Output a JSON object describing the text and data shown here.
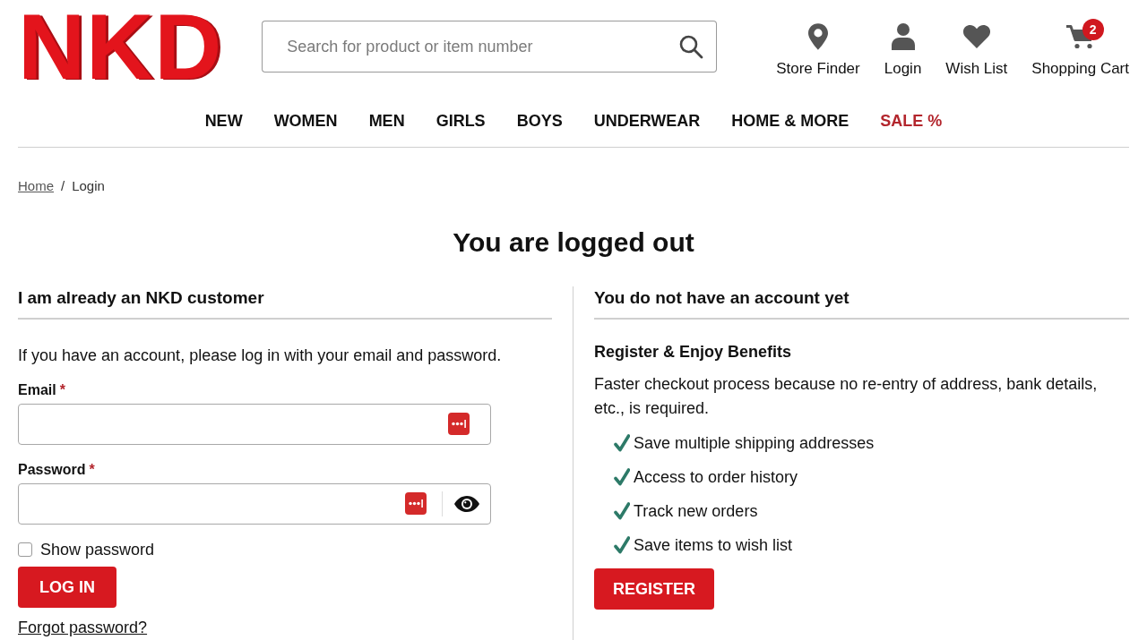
{
  "header": {
    "logo": "NKD",
    "search": {
      "placeholder": "Search for product or item number"
    },
    "actions": [
      {
        "kind": "store",
        "label": "Store Finder"
      },
      {
        "kind": "account",
        "label": "Login"
      },
      {
        "kind": "wishlist",
        "label": "Wish List"
      },
      {
        "kind": "cart",
        "label": "Shopping Cart",
        "badge": "2"
      }
    ]
  },
  "nav": [
    {
      "label": "NEW",
      "kind": "regular"
    },
    {
      "label": "WOMEN",
      "kind": "regular"
    },
    {
      "label": "MEN",
      "kind": "regular"
    },
    {
      "label": "GIRLS",
      "kind": "regular"
    },
    {
      "label": "BOYS",
      "kind": "regular"
    },
    {
      "label": "UNDERWEAR",
      "kind": "regular"
    },
    {
      "label": "HOME & MORE",
      "kind": "regular"
    },
    {
      "label": "SALE %",
      "kind": "sale"
    }
  ],
  "breadcrumb": {
    "separator": "/",
    "items": [
      {
        "label": "Home",
        "kind": "link"
      },
      {
        "label": "Login",
        "kind": "current"
      }
    ]
  },
  "title": "You are logged out",
  "login": {
    "heading": "I am already an NKD customer",
    "intro": "If you have an account, please log in with your email and password.",
    "fields": [
      {
        "kind": "email",
        "label": "Email",
        "required_mark": "*"
      },
      {
        "kind": "password",
        "label": "Password",
        "required_mark": "*"
      }
    ],
    "show_password": {
      "label": "Show password",
      "checked": false
    },
    "submit": "LOG IN",
    "forgot_link": "Forgot password?"
  },
  "register": {
    "heading": "You do not have an account yet",
    "subheading": "Register & Enjoy Benefits",
    "text": "Faster checkout process because no re-entry of address, bank details, etc., is required.",
    "benefits": [
      "Save multiple shipping addresses",
      "Access to order history",
      "Track new orders",
      "Save items to wish list"
    ],
    "button": "REGISTER"
  }
}
